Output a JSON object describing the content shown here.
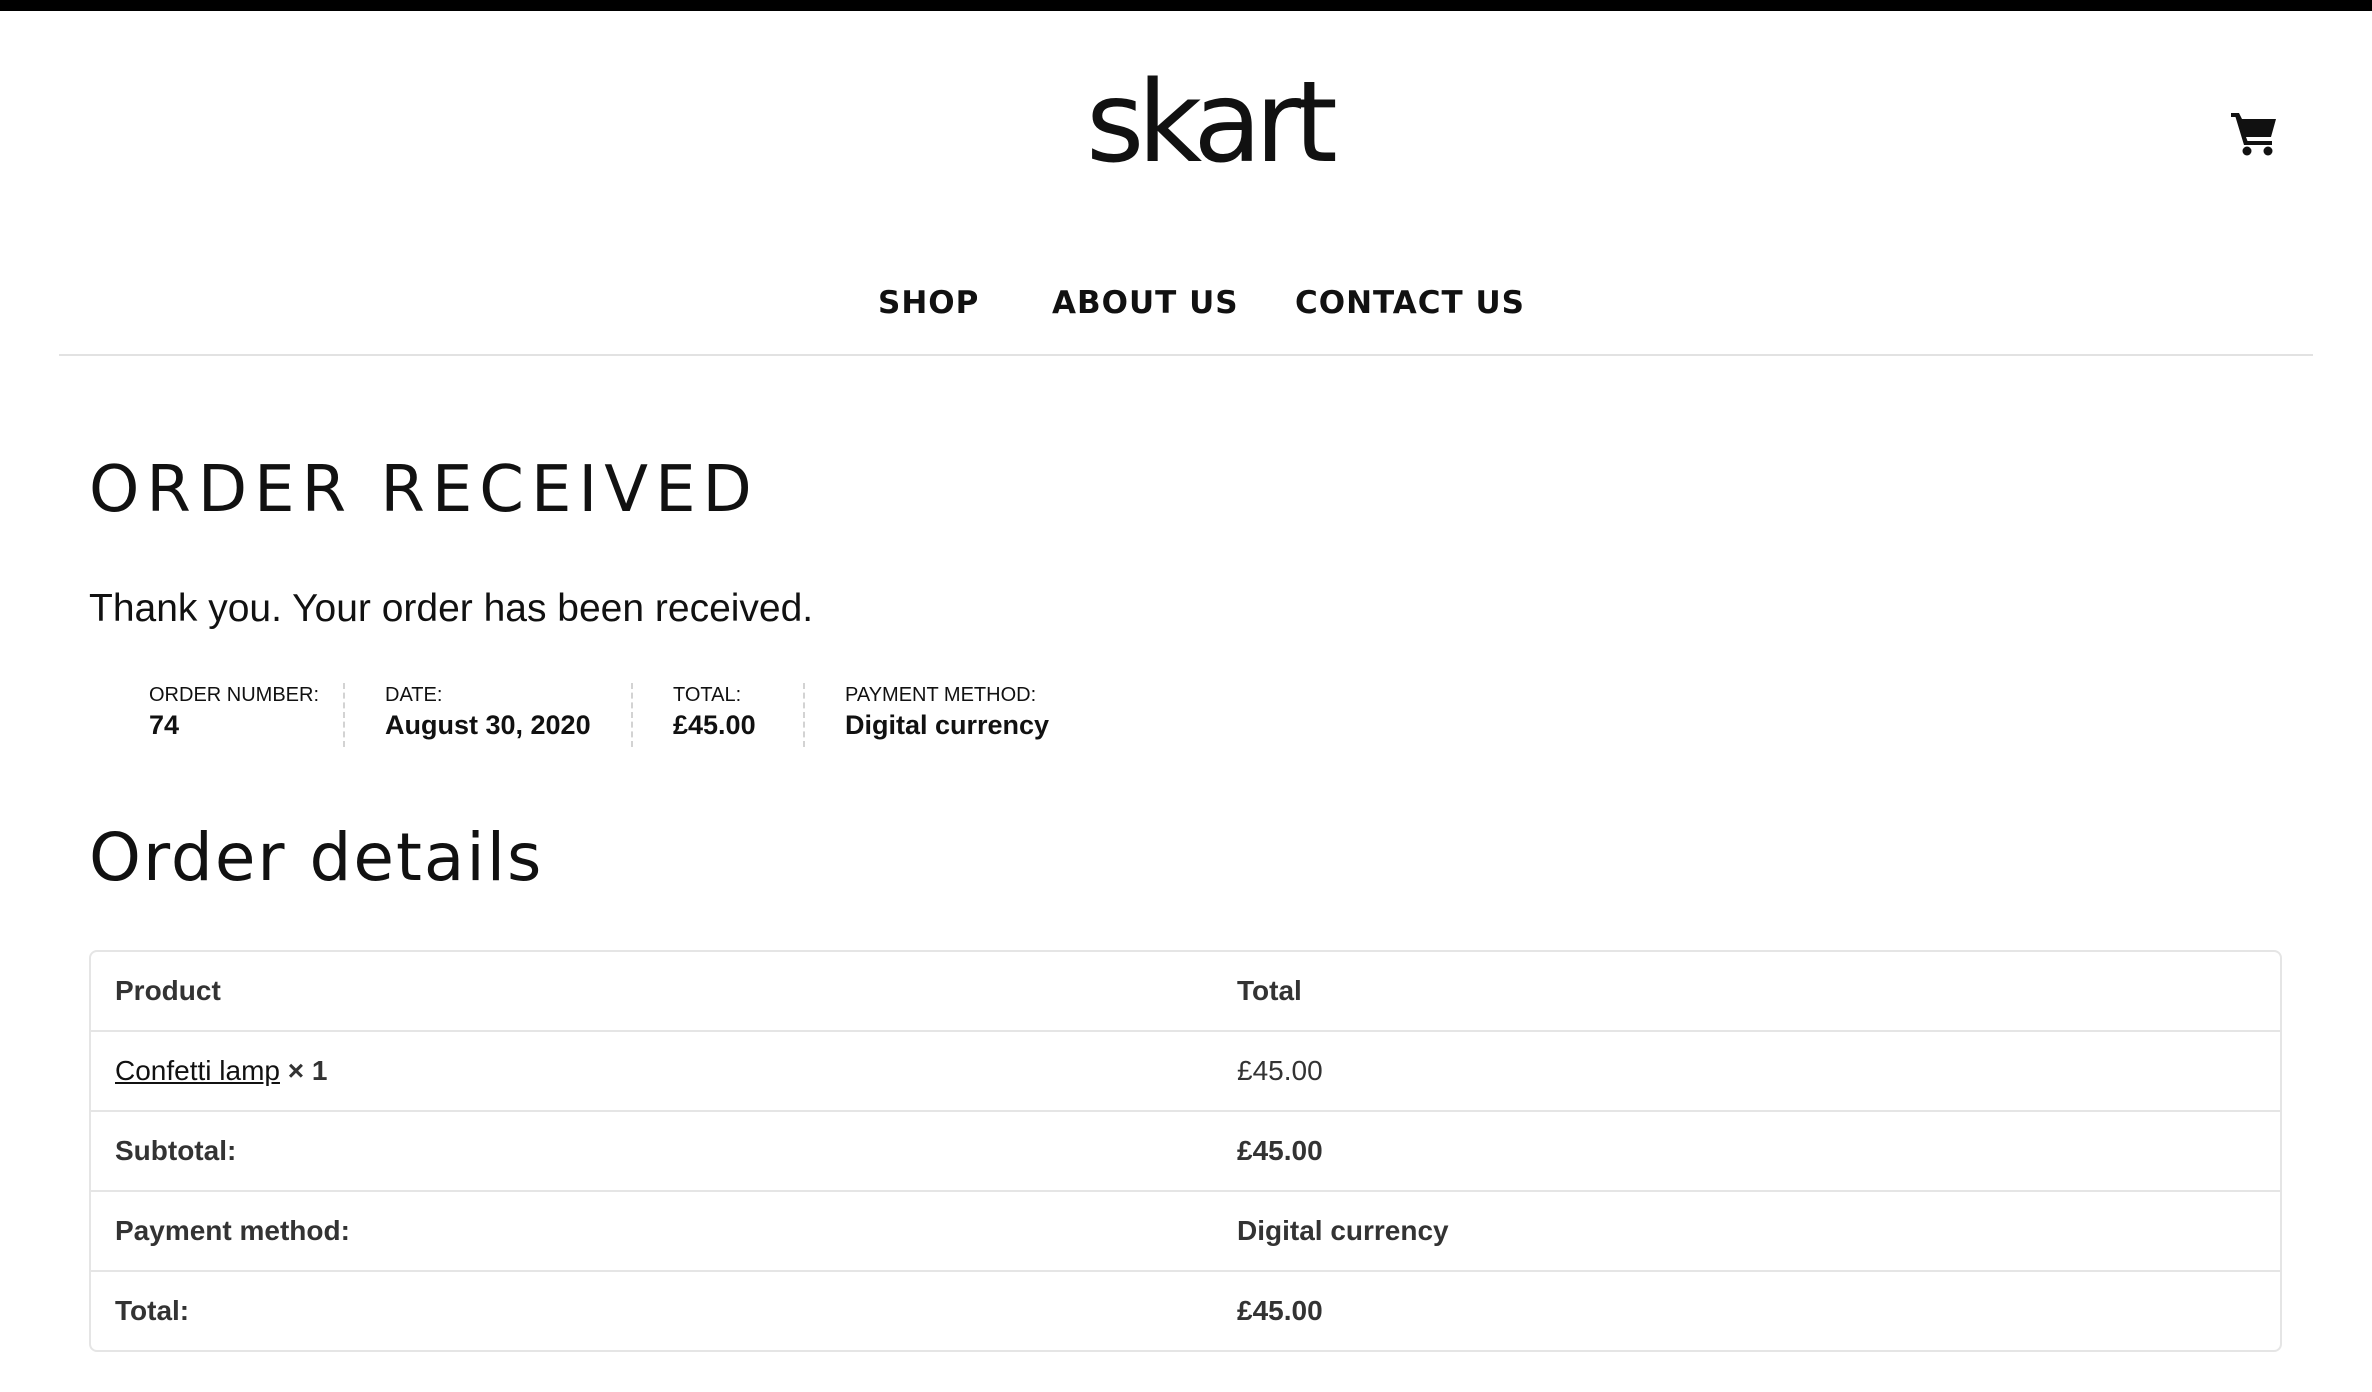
{
  "header": {
    "logo_text": "skart",
    "cart_icon": "shopping-cart-icon",
    "nav": {
      "shop": "SHOP",
      "about": "ABOUT US",
      "contact": "CONTACT US"
    }
  },
  "page": {
    "title": "ORDER RECEIVED",
    "thank_you": "Thank you. Your order has been received."
  },
  "overview": {
    "order_number_label": "ORDER NUMBER:",
    "order_number": "74",
    "date_label": "DATE:",
    "date": "August 30, 2020",
    "total_label": "TOTAL:",
    "total": "£45.00",
    "payment_label": "PAYMENT METHOD:",
    "payment": "Digital currency"
  },
  "details": {
    "title": "Order details",
    "columns": {
      "product": "Product",
      "total": "Total"
    },
    "item": {
      "name": "Confetti lamp",
      "qty": "× 1",
      "total": "£45.00"
    },
    "rows": [
      {
        "label": "Subtotal:",
        "value": "£45.00"
      },
      {
        "label": "Payment method:",
        "value": "Digital currency"
      },
      {
        "label": "Total:",
        "value": "£45.00"
      }
    ]
  }
}
